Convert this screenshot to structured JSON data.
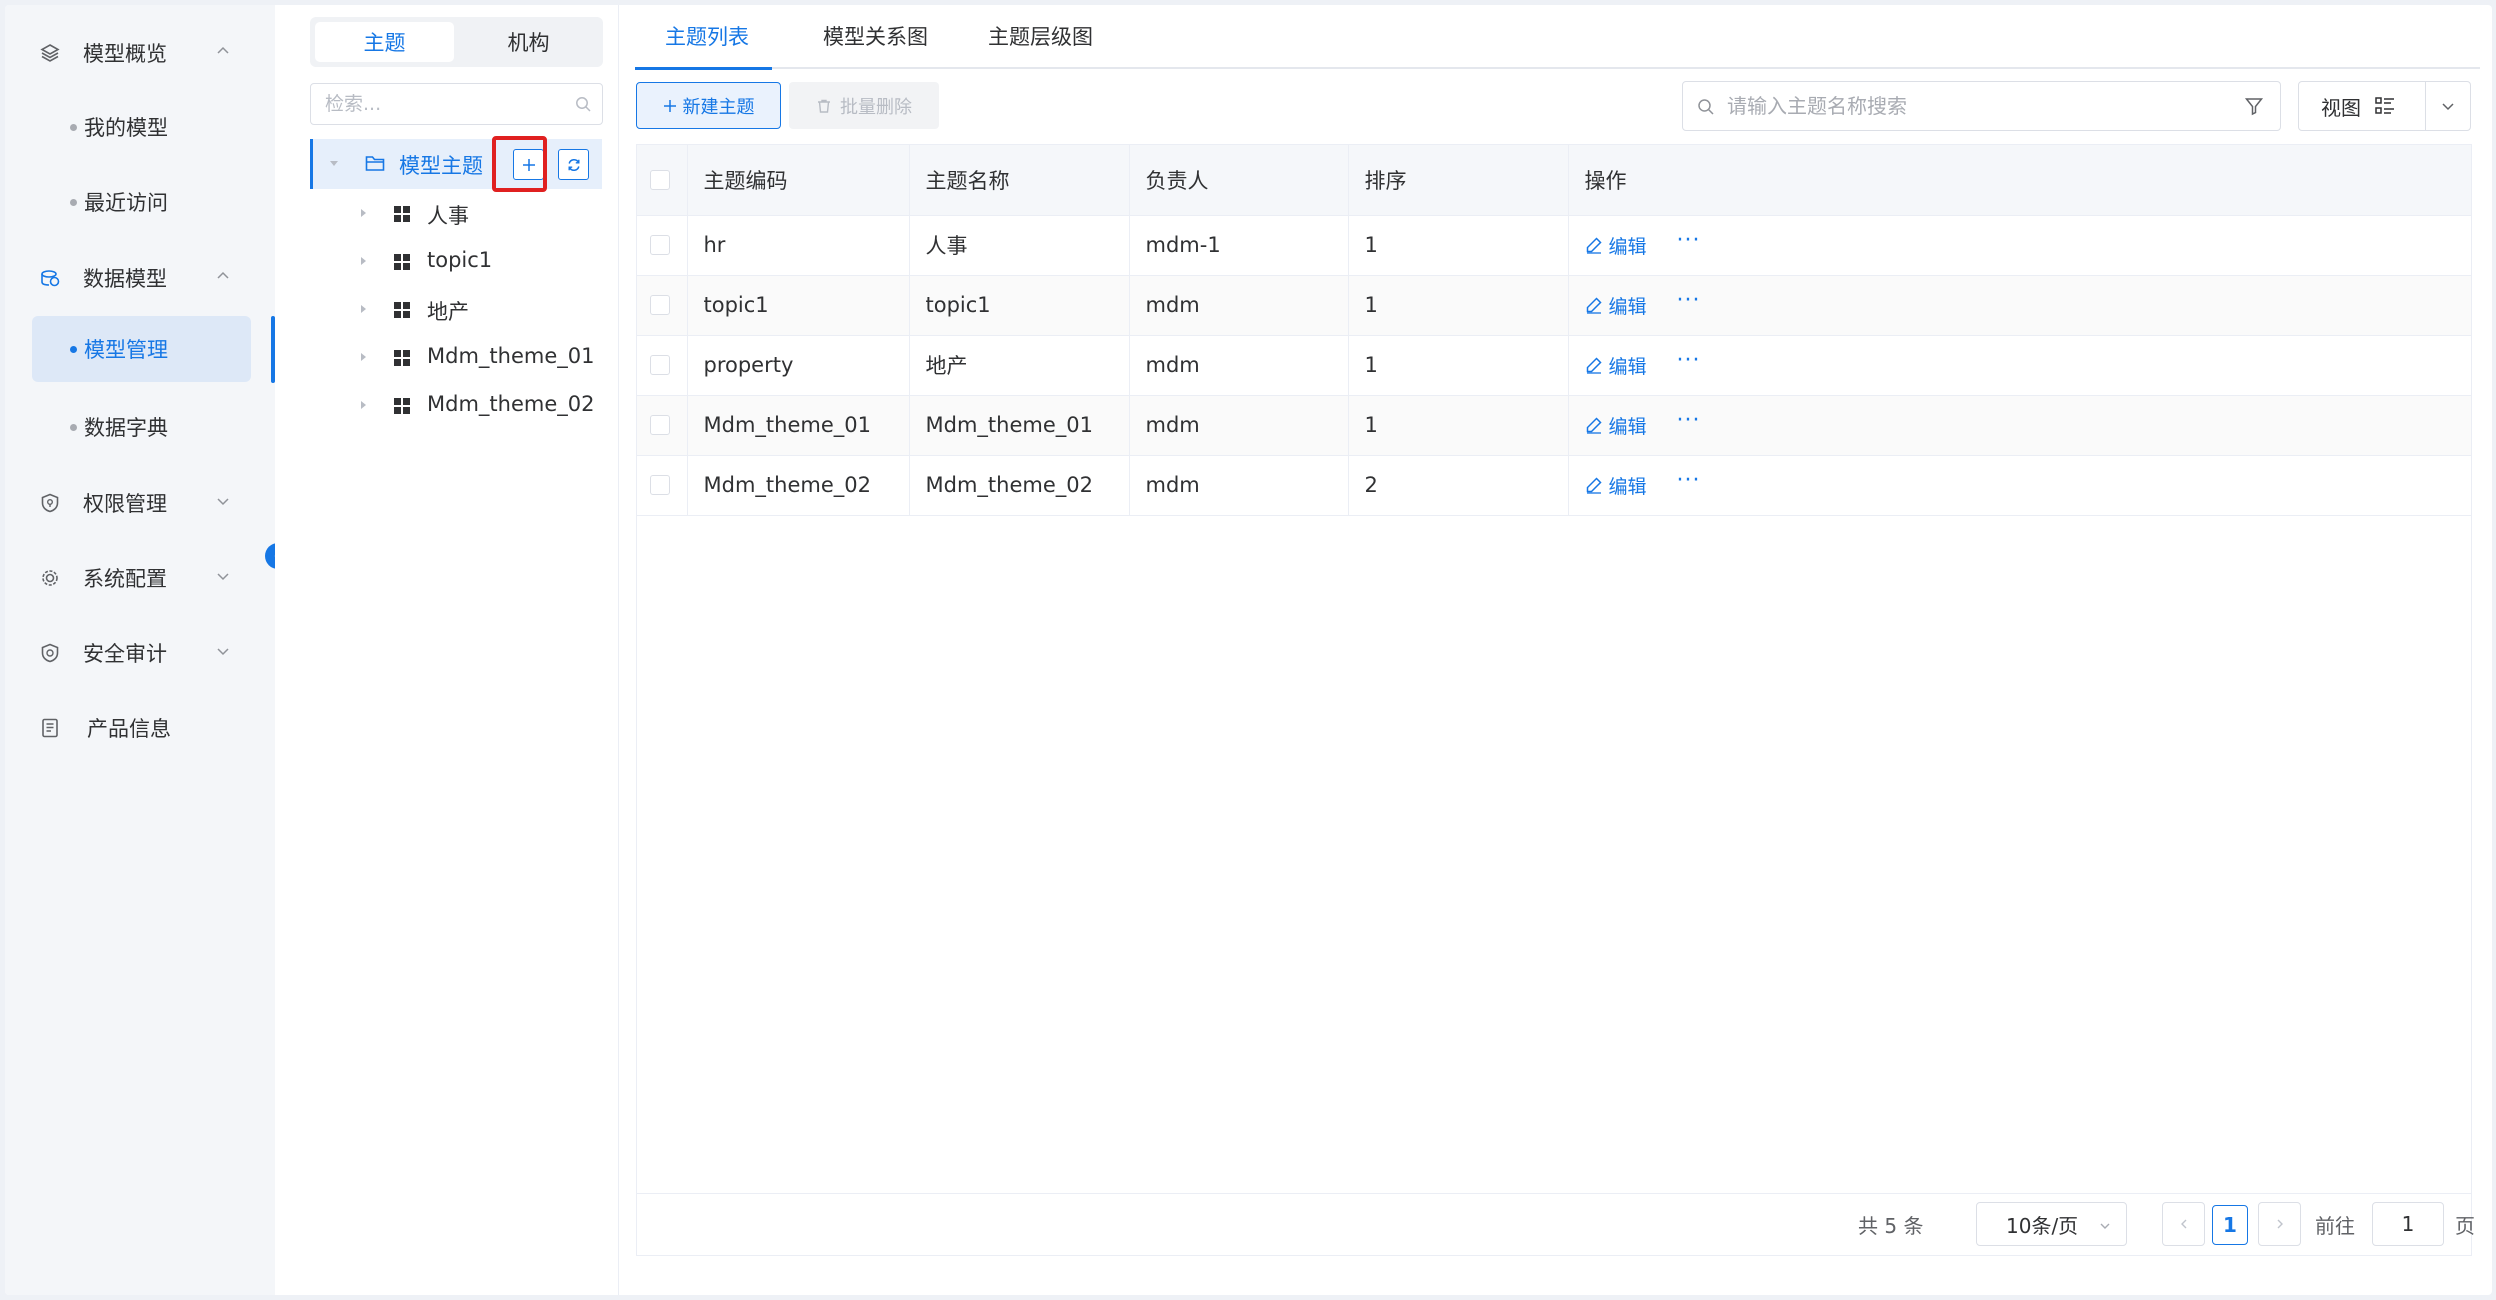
{
  "sidebar": {
    "groups": [
      {
        "label": "模型概览",
        "icon": "layers-icon",
        "expanded": true
      },
      {
        "label": "数据模型",
        "icon": "data-model-icon",
        "expanded": true
      },
      {
        "label": "权限管理",
        "icon": "shield-icon",
        "expanded": false
      },
      {
        "label": "系统配置",
        "icon": "settings-icon",
        "expanded": false
      },
      {
        "label": "安全审计",
        "icon": "audit-shield-icon",
        "expanded": false
      },
      {
        "label": "产品信息",
        "icon": "document-icon"
      }
    ],
    "subitems": [
      {
        "label": "我的模型"
      },
      {
        "label": "最近访问"
      },
      {
        "label": "模型管理",
        "active": true
      },
      {
        "label": "数据字典"
      }
    ]
  },
  "tree_panel": {
    "segments": [
      "主题",
      "机构"
    ],
    "active_segment": "主题",
    "search_placeholder": "检索...",
    "root": {
      "label": "模型主题"
    },
    "nodes": [
      "人事",
      "topic1",
      "地产",
      "Mdm_theme_01",
      "Mdm_theme_02"
    ]
  },
  "main": {
    "tabs": [
      "主题列表",
      "模型关系图",
      "主题层级图"
    ],
    "active_tab": "主题列表",
    "toolbar": {
      "new_label": "新建主题",
      "delete_label": "批量删除",
      "search_placeholder": "请输入主题名称搜索",
      "view_label": "视图"
    },
    "table": {
      "columns": [
        "主题编码",
        "主题名称",
        "负责人",
        "排序",
        "操作"
      ],
      "rows": [
        {
          "code": "hr",
          "name": "人事",
          "owner": "mdm-1",
          "order": "1"
        },
        {
          "code": "topic1",
          "name": "topic1",
          "owner": "mdm",
          "order": "1"
        },
        {
          "code": "property",
          "name": "地产",
          "owner": "mdm",
          "order": "1"
        },
        {
          "code": "Mdm_theme_01",
          "name": "Mdm_theme_01",
          "owner": "mdm",
          "order": "1"
        },
        {
          "code": "Mdm_theme_02",
          "name": "Mdm_theme_02",
          "owner": "mdm",
          "order": "2"
        }
      ],
      "edit_label": "编辑",
      "more_label": "···"
    },
    "pagination": {
      "total_text": "共 5 条",
      "page_size": "10条/页",
      "current_page": "1",
      "goto_label": "前往",
      "goto_value": "1",
      "page_unit": "页"
    }
  },
  "colors": {
    "accent": "#1677e5",
    "highlight": "#e02020",
    "sidebar_bg": "#f4f6f9"
  }
}
